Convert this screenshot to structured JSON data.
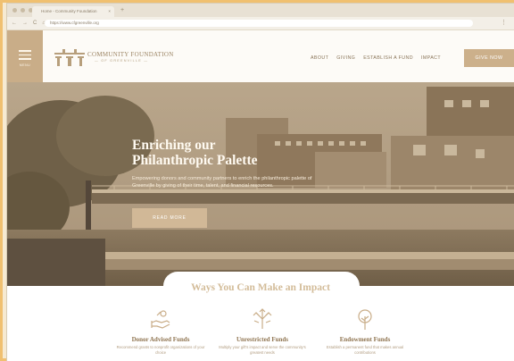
{
  "browser": {
    "tab_title": "Home - Community Foundation",
    "tab_close": "×",
    "new_tab": "+",
    "url": "https://www.cfgreenville.org",
    "nav_back": "←",
    "nav_forward": "→",
    "nav_reload": "C",
    "nav_home": "⌂",
    "menu": "⋮"
  },
  "header": {
    "menu_label": "MENU",
    "logo_line1": "COMMUNITY FOUNDATION",
    "logo_line2": "— OF GREENVILLE —",
    "nav": [
      "ABOUT",
      "GIVING",
      "ESTABLISH A FUND",
      "IMPACT"
    ],
    "give_now": "GIVE NOW"
  },
  "hero": {
    "headline_line1": "Enriching our",
    "headline_line2": "Philanthropic Palette",
    "subtext": "Empowering donors and community partners to enrich the philanthropic palette of Greenville by giving of their time, talent, and financial resources.",
    "cta": "READ MORE"
  },
  "ways": {
    "heading": "Ways You Can Make an Impact",
    "cards": [
      {
        "title": "Donor Advised Funds",
        "desc": "Recommend grants to nonprofit organizations of your choice",
        "icon": "hand-giving-icon"
      },
      {
        "title": "Unrestricted Funds",
        "desc": "Multiply your gift's impact and serve the community's greatest needs",
        "icon": "arrows-expand-icon"
      },
      {
        "title": "Endowment Funds",
        "desc": "Establish a permanent fund that makes annual contributions",
        "icon": "tree-icon"
      }
    ]
  },
  "colors": {
    "accent": "#c9ad88",
    "background": "#f6ead2",
    "heading": "#8f7450"
  }
}
